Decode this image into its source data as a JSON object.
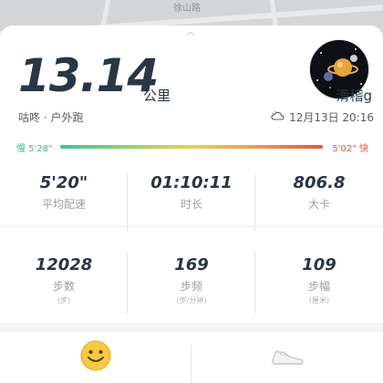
{
  "map": {
    "label": "徐山路"
  },
  "summary": {
    "distance": "13.14",
    "unit": "公里",
    "username": "滑稽g",
    "activity": "咕咚 · 户外跑",
    "datetime": "12月13日 20:16"
  },
  "pace_bar": {
    "slow_label": "慢 5'28\"",
    "fast_label": "5'02\" 快"
  },
  "stats": [
    {
      "value": "5'20\"",
      "label": "平均配速",
      "sub": ""
    },
    {
      "value": "01:10:11",
      "label": "时长",
      "sub": ""
    },
    {
      "value": "806.8",
      "label": "大卡",
      "sub": ""
    },
    {
      "value": "12028",
      "label": "步数",
      "sub": "(步)"
    },
    {
      "value": "169",
      "label": "步频",
      "sub": "(步/分钟)"
    },
    {
      "value": "109",
      "label": "步幅",
      "sub": "(厘米)"
    }
  ],
  "tabs": [
    {
      "icon": "smiley-icon"
    },
    {
      "icon": "sneaker-icon"
    }
  ],
  "colors": {
    "pace_slow": "#3cbf8a",
    "pace_fast": "#e8553f",
    "text_dark": "#2a3646"
  }
}
